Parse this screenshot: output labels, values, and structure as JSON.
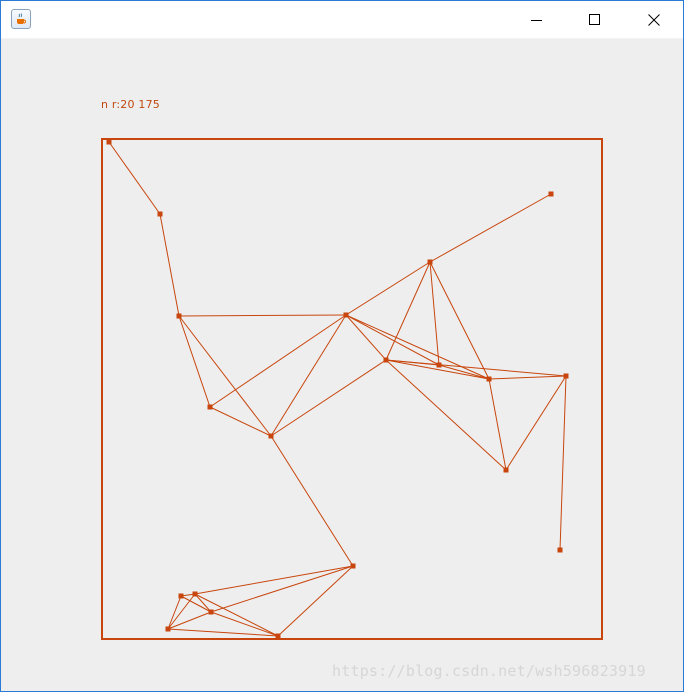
{
  "window": {
    "title": "",
    "controls": {
      "minimize": "minimize-icon",
      "maximize": "maximize-icon",
      "close": "close-icon"
    }
  },
  "canvas": {
    "info_text": "n r:20  175",
    "watermark": "https://blog.csdn.net/wsh596823919"
  },
  "colors": {
    "stroke": "#c8460d",
    "background": "#eeeeee"
  }
}
